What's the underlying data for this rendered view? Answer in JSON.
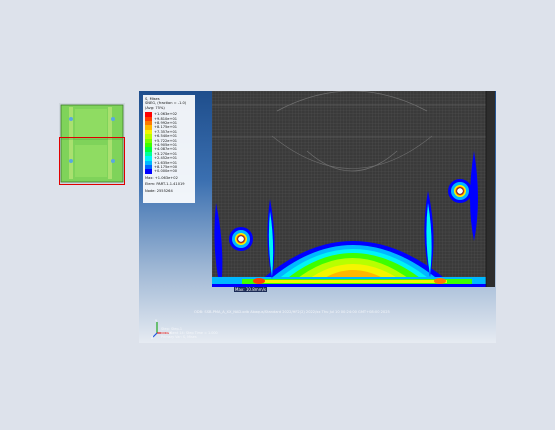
{
  "legend": {
    "title": "S, Mises",
    "line2": "SNEG, (fraction = -1.0)",
    "line3": "(Avg: 75%)",
    "colors": [
      "#ff0000",
      "#ff3d00",
      "#ff7a00",
      "#ffb800",
      "#f5f500",
      "#b8ff00",
      "#7aff00",
      "#3dff00",
      "#00ff3d",
      "#00ff9a",
      "#00f5f5",
      "#00b8ff",
      "#0066ff",
      "#0000ff"
    ],
    "values": [
      "+1.063e+02",
      "+9.810e+01",
      "+8.992e+01",
      "+8.175e+01",
      "+7.357e+01",
      "+6.540e+01",
      "+5.722e+01",
      "+4.905e+01",
      "+4.087e+01",
      "+3.270e+01",
      "+2.452e+01",
      "+1.635e+01",
      "+8.175e+00",
      "+0.000e+00"
    ],
    "max": "Max: +1.063e+02",
    "elem": "Elem: PART-1-1.41019",
    "node": "Node: 2555264"
  },
  "viewport": {
    "node_tag": "Max: 10.8mm/s",
    "status_line": "ODB: SSB-PMA_A_XX_NAD.odb   Abaqus/Standard 2022/HF2(2) 2022/xx   Thu Jul 10 00:24:00 GMT+08:00 2025",
    "step_line1": "Step: Step-1",
    "step_line2": "Increment 14: Step Time = 1.000",
    "step_line3": "Primary Var: S, Mises"
  },
  "axes": {
    "x": "X",
    "y": "Y",
    "z": "Z"
  }
}
